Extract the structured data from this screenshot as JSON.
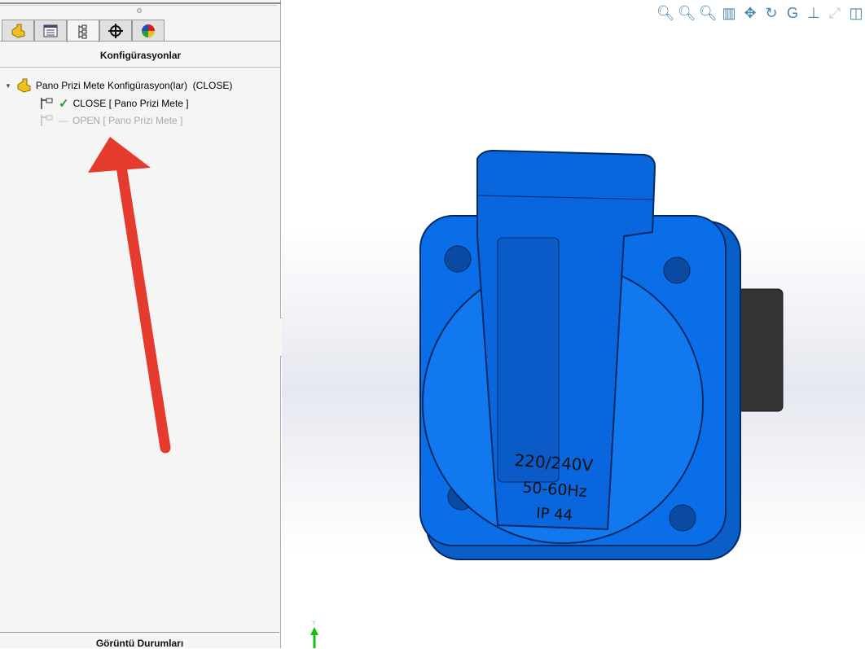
{
  "panel": {
    "title": "Konfigürasyonlar",
    "tabs": [
      "feature-manager",
      "property-manager",
      "configuration-manager",
      "dimxpert-manager",
      "display-manager"
    ],
    "tree": {
      "root": "Pano Prizi Mete Konfigürasyon(lar)  (CLOSE)",
      "items": [
        {
          "label": "CLOSE [ Pano Prizi Mete ]",
          "active": true
        },
        {
          "label": "OPEN [ Pano Prizi Mete ]",
          "active": false
        }
      ]
    },
    "bottom_title": "Görüntü Durumları"
  },
  "toolbar": [
    "zoom-to-fit",
    "zoom-to-area",
    "zoom-selection",
    "section-view",
    "pan",
    "rotate",
    "roll",
    "normal-to",
    "zoom-disabled",
    "view-orientation"
  ],
  "model": {
    "label_lines": [
      "220/240V",
      "50-60Hz",
      "IP 44"
    ],
    "color": "#0a6ee8"
  },
  "axis": {
    "label": "Y"
  },
  "annotation": {
    "arrow_color": "#e53b2f"
  }
}
